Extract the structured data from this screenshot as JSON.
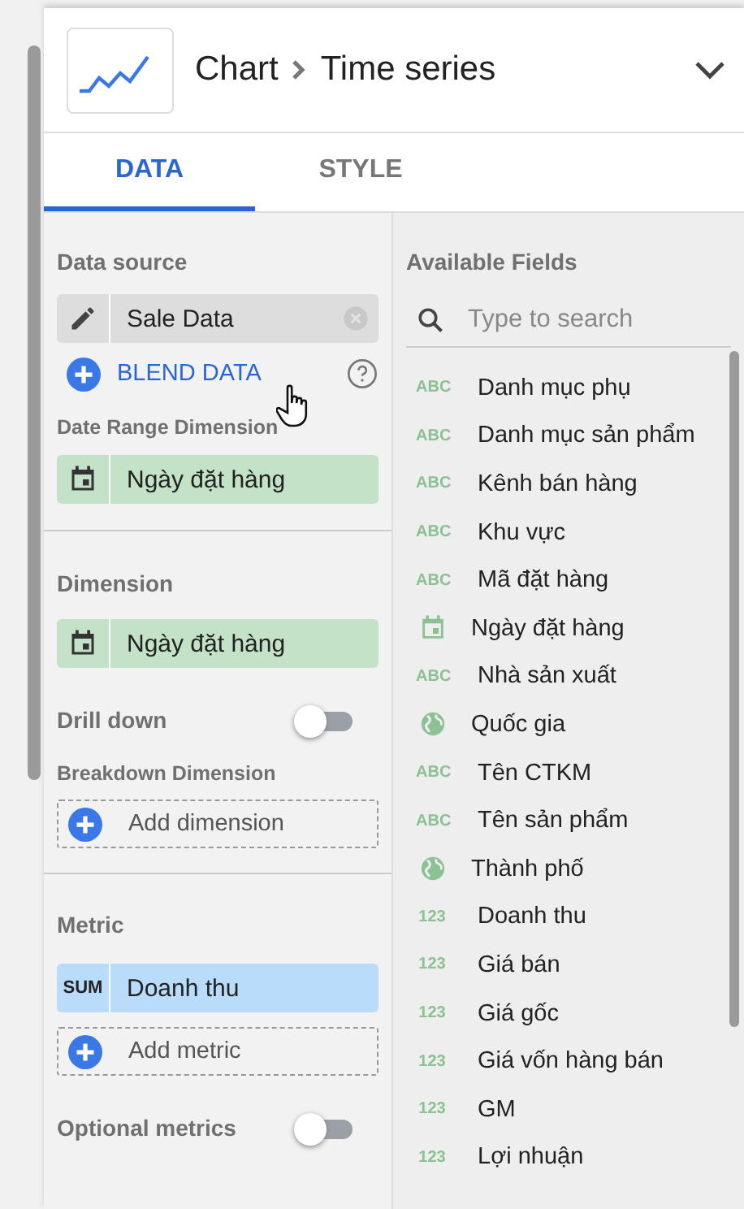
{
  "header": {
    "title": "Chart",
    "subtitle": "Time series"
  },
  "tabs": [
    {
      "label": "DATA",
      "selected": true
    },
    {
      "label": "STYLE",
      "selected": false
    }
  ],
  "data_source": {
    "heading": "Data source",
    "name": "Sale Data",
    "blend_label": "BLEND DATA"
  },
  "date_range": {
    "heading": "Date Range Dimension",
    "chip": {
      "kind": "date",
      "field": "Ngày đặt hàng"
    }
  },
  "dimension": {
    "heading": "Dimension",
    "chip": {
      "kind": "date",
      "field": "Ngày đặt hàng"
    }
  },
  "drill_down": {
    "label": "Drill down",
    "on": false
  },
  "breakdown": {
    "heading": "Breakdown Dimension",
    "add_label": "Add dimension"
  },
  "metric": {
    "heading": "Metric",
    "chip": {
      "kind": "metric",
      "aggregation": "SUM",
      "field": "Doanh thu"
    },
    "add_label": "Add metric"
  },
  "optional_metrics": {
    "label": "Optional metrics",
    "on": false
  },
  "available_fields": {
    "heading": "Available Fields",
    "search_placeholder": "Type to search",
    "fields": [
      {
        "kind": "text",
        "badge": "ABC",
        "name": "Danh mục phụ"
      },
      {
        "kind": "text",
        "badge": "ABC",
        "name": "Danh mục sản phẩm"
      },
      {
        "kind": "text",
        "badge": "ABC",
        "name": "Kênh bán hàng"
      },
      {
        "kind": "text",
        "badge": "ABC",
        "name": "Khu vực"
      },
      {
        "kind": "text",
        "badge": "ABC",
        "name": "Mã đặt hàng"
      },
      {
        "kind": "date",
        "name": "Ngày đặt hàng"
      },
      {
        "kind": "text",
        "badge": "ABC",
        "name": "Nhà sản xuất"
      },
      {
        "kind": "geo",
        "name": "Quốc gia"
      },
      {
        "kind": "text",
        "badge": "ABC",
        "name": "Tên CTKM"
      },
      {
        "kind": "text",
        "badge": "ABC",
        "name": "Tên sản phẩm"
      },
      {
        "kind": "geo",
        "name": "Thành phố"
      },
      {
        "kind": "number",
        "badge": "123",
        "name": "Doanh thu"
      },
      {
        "kind": "number",
        "badge": "123",
        "name": "Giá bán"
      },
      {
        "kind": "number",
        "badge": "123",
        "name": "Giá gốc"
      },
      {
        "kind": "number",
        "badge": "123",
        "name": "Giá vốn hàng bán"
      },
      {
        "kind": "number",
        "badge": "123",
        "name": "GM"
      },
      {
        "kind": "number",
        "badge": "123",
        "name": "Lợi nhuận"
      }
    ]
  }
}
